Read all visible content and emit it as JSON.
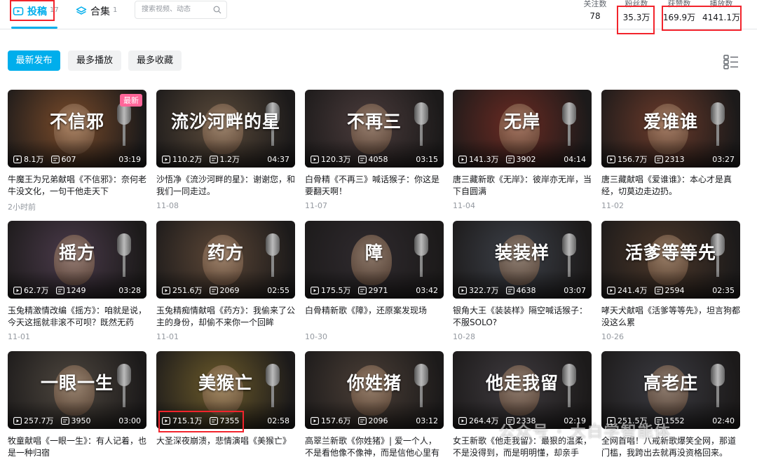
{
  "tabs": {
    "posts": {
      "label": "投稿",
      "count": "17"
    },
    "collections": {
      "label": "合集",
      "count": "1"
    }
  },
  "search": {
    "placeholder": "搜索视频、动态"
  },
  "stats": [
    {
      "label": "关注数",
      "value": "78"
    },
    {
      "label": "粉丝数",
      "value": "35.3万"
    },
    {
      "label": "获赞数",
      "value": "169.9万"
    },
    {
      "label": "播放数",
      "value": "4141.1万"
    }
  ],
  "filters": [
    "最新发布",
    "最多播放",
    "最多收藏"
  ],
  "videos": [
    {
      "song": "不信邪",
      "plays": "8.1万",
      "danmaku": "607",
      "duration": "03:19",
      "badge": "最新",
      "title": "牛魔王为兄弟献唱《不信邪》：奈何老牛没文化，一句干他走天下",
      "date": "2小时前",
      "tone": "#7a4b2a"
    },
    {
      "song": "流沙河畔的星",
      "plays": "110.2万",
      "danmaku": "1.2万",
      "duration": "04:37",
      "badge": "",
      "title": "沙悟净《流沙河畔的星》：谢谢您，和我们一同走过。",
      "date": "11-08",
      "tone": "#5a4a3a"
    },
    {
      "song": "不再三",
      "plays": "120.3万",
      "danmaku": "4058",
      "duration": "03:15",
      "badge": "",
      "title": "白骨精《不再三》喊话猴子：你这是要翻天啊！",
      "date": "11-07",
      "tone": "#4a3b3b"
    },
    {
      "song": "无岸",
      "plays": "141.3万",
      "danmaku": "3902",
      "duration": "04:14",
      "badge": "",
      "title": "唐三藏新歌《无岸》：彼岸亦无岸，当下自圆满",
      "date": "11-04",
      "tone": "#6a2a22"
    },
    {
      "song": "爱谁谁",
      "plays": "156.7万",
      "danmaku": "2313",
      "duration": "03:27",
      "badge": "",
      "title": "唐三藏献唱《爱谁谁》：本心才是真经，切莫边走边扔。",
      "date": "11-02",
      "tone": "#6b3a2a"
    },
    {
      "song": "摇方",
      "plays": "62.7万",
      "danmaku": "1249",
      "duration": "03:28",
      "badge": "",
      "title": "玉兔精激情改编《摇方》：咱就是说，今天这摇就非滚不可呗？既然无药可…",
      "date": "11-01",
      "tone": "#4a3a4a"
    },
    {
      "song": "药方",
      "plays": "251.6万",
      "danmaku": "2069",
      "duration": "02:55",
      "badge": "",
      "title": "玉兔精痴情献唱《药方》：我偷来了公主的身份，却偷不来你一个回眸",
      "date": "11-01",
      "tone": "#5b4636"
    },
    {
      "song": "障",
      "plays": "175.5万",
      "danmaku": "2971",
      "duration": "03:42",
      "badge": "",
      "title": "白骨精新歌《障》，还原案发现场",
      "date": "10-30",
      "tone": "#2f2a2e"
    },
    {
      "song": "装装样",
      "plays": "322.7万",
      "danmaku": "4638",
      "duration": "03:07",
      "badge": "",
      "title": "银角大王《装装样》隔空喊话猴子：不服SOLO?",
      "date": "10-28",
      "tone": "#3c4048"
    },
    {
      "song": "活爹等等先",
      "plays": "241.4万",
      "danmaku": "2594",
      "duration": "02:35",
      "badge": "",
      "title": "哮天犬献唱《活爹等等先》，坦言狗都没这么累",
      "date": "10-26",
      "tone": "#4a3628"
    },
    {
      "song": "一眼一生",
      "plays": "257.7万",
      "danmaku": "3950",
      "duration": "03:00",
      "badge": "",
      "title": "牧童献唱《一眼一生》：有人记着，也是一种归宿",
      "date": "10-25",
      "tone": "#4d463e"
    },
    {
      "song": "美猴亡",
      "plays": "715.1万",
      "danmaku": "7355",
      "duration": "02:58",
      "badge": "",
      "title": "大圣深夜崩溃，悲情演唱《美猴亡》",
      "date": "10-24",
      "tone": "#6b5a2a"
    },
    {
      "song": "你姓猪",
      "plays": "157.6万",
      "danmaku": "2096",
      "duration": "03:12",
      "badge": "",
      "title": "高翠兰新歌《你姓猪》| 爱一个人，不是看他像不像神，而是信他心里有光。",
      "date": "10-22",
      "tone": "#4a3e36"
    },
    {
      "song": "他走我留",
      "plays": "264.4万",
      "danmaku": "2338",
      "duration": "02:19",
      "badge": "",
      "title": "女王新歌《他走我留》：最狠的温柔，不是没得到，而是明明懂，却亲手放…",
      "date": "10-21",
      "tone": "#3e3a3e"
    },
    {
      "song": "高老庄",
      "plays": "251.5万",
      "danmaku": "1552",
      "duration": "02:40",
      "badge": "",
      "title": "全网首唱！八戒新歌爆笑全网，那道门槛，我跨出去就再没资格回来。",
      "date": "10-21",
      "tone": "#3a3a40"
    }
  ],
  "watermark": "公众号 · 大白学智能体"
}
